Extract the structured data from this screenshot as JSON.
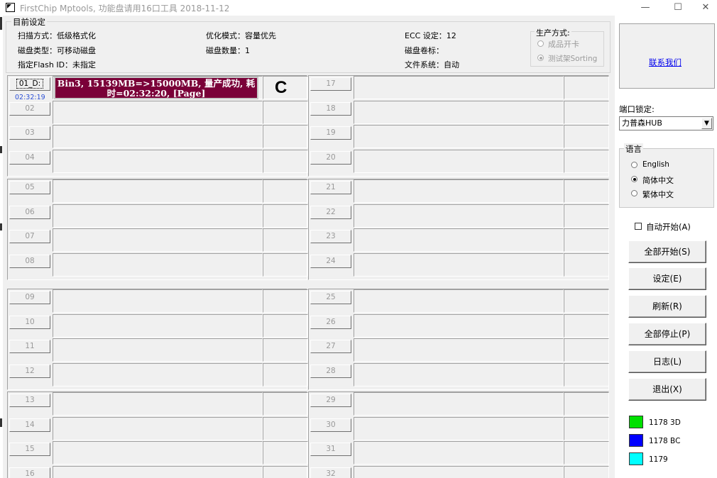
{
  "window": {
    "title": "FirstChip Mptools, 功能盘请用16口工具   2018-11-12",
    "minimize": "—",
    "maximize": "☐",
    "close": "✕"
  },
  "settings": {
    "group_label": "目前设定",
    "scan_mode": "扫描方式：低级格式化",
    "disk_type": "磁盘类型：可移动磁盘",
    "flash_id": "指定Flash ID：未指定",
    "opt_mode": "优化模式：容量优先",
    "disk_count": "磁盘数量：1",
    "ecc": "ECC 设定：12",
    "volume_label": "磁盘卷标：",
    "filesystem": "文件系统：自动"
  },
  "production": {
    "label": "生产方式:",
    "option_card": "成品开卡",
    "option_sorting": "测试架Sorting"
  },
  "ports": {
    "active": {
      "label": "01_D:",
      "time": "02:32:19",
      "status": "Bin3, 15139MB=>15000MB, 量产成功, 耗时=02:32:20, [Page]",
      "drive": "C"
    },
    "left": [
      "02",
      "03",
      "04",
      "05",
      "06",
      "07",
      "08",
      "09",
      "10",
      "11",
      "12",
      "13",
      "14",
      "15",
      "16"
    ],
    "right": [
      "17",
      "18",
      "19",
      "20",
      "21",
      "22",
      "23",
      "24",
      "25",
      "26",
      "27",
      "28",
      "29",
      "30",
      "31",
      "32"
    ]
  },
  "sidebar": {
    "contact": "联系我们",
    "port_lock_label": "端口锁定:",
    "port_lock_value": "力普森HUB",
    "lang_label": "语言",
    "lang_english": "English",
    "lang_simplified": "简体中文",
    "lang_traditional": "繁体中文",
    "auto_start": "自动开始(A)",
    "buttons": {
      "start_all": "全部开始(S)",
      "settings": "设定(E)",
      "refresh": "刷新(R)",
      "stop_all": "全部停止(P)",
      "log": "日志(L)",
      "exit": "退出(X)"
    },
    "legend": [
      {
        "color": "#00e000",
        "label": "1178 3D"
      },
      {
        "color": "#0000ff",
        "label": "1178 BC"
      },
      {
        "color": "#00ffff",
        "label": "1179"
      }
    ]
  }
}
